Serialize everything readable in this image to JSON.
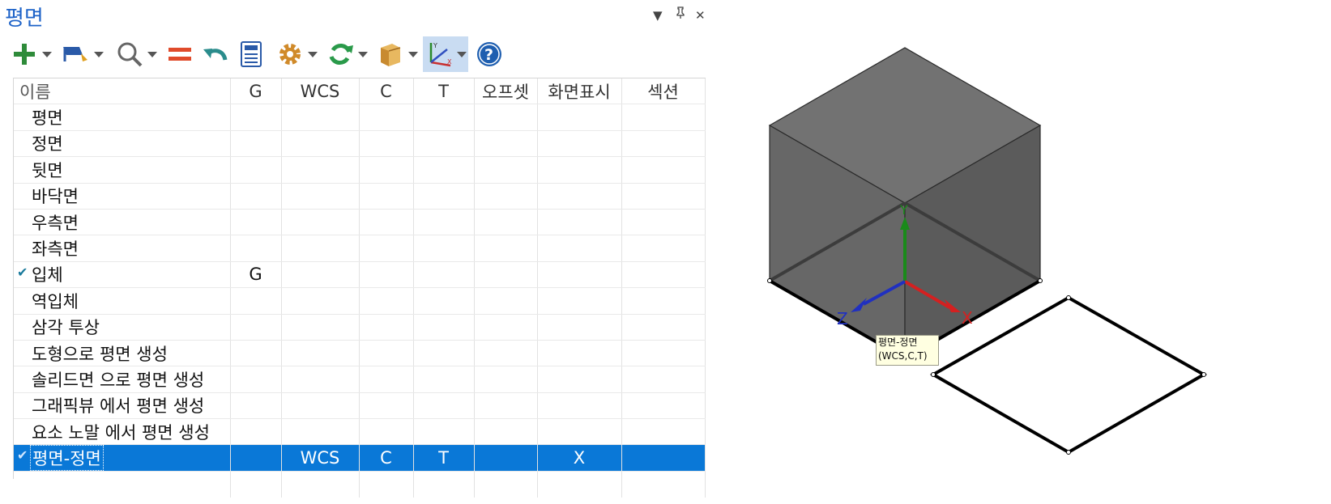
{
  "panel": {
    "title": "평면"
  },
  "window_controls": {
    "dropdown": "▼",
    "pin": "ᵖ",
    "close": "✕"
  },
  "toolbar": {
    "buttons": [
      {
        "icon": "plus-icon",
        "color": "#2e8b3a",
        "has_dropdown": true
      },
      {
        "icon": "plane-flag-icon",
        "color": "#2a5aa8",
        "has_dropdown": true
      },
      {
        "icon": "search-icon",
        "color": "#666666",
        "has_dropdown": true
      },
      {
        "icon": "equals-icon",
        "color": "#e04b2b",
        "has_dropdown": false
      },
      {
        "icon": "undo-icon",
        "color": "#2a8c8c",
        "has_dropdown": false
      },
      {
        "icon": "calculator-icon",
        "color": "#2a5aa8",
        "has_dropdown": false
      },
      {
        "icon": "gear-icon",
        "color": "#d08a2a",
        "has_dropdown": true
      },
      {
        "icon": "refresh-icon",
        "color": "#2a9a4a",
        "has_dropdown": true
      },
      {
        "icon": "box-icon",
        "color": "#d8a040",
        "has_dropdown": true
      },
      {
        "icon": "axes-icon",
        "color": "#6a7a9a",
        "has_dropdown": true,
        "active": true
      },
      {
        "icon": "help-icon",
        "color": "#1f5fb0",
        "has_dropdown": false
      }
    ]
  },
  "table": {
    "columns": [
      "이름",
      "G",
      "WCS",
      "C",
      "T",
      "오프셋",
      "화면표시",
      "섹션"
    ],
    "rows": [
      {
        "name": "평면",
        "g": "",
        "wcs": "",
        "c": "",
        "t": "",
        "offset": "",
        "display": "",
        "section": "",
        "checked": false
      },
      {
        "name": "정면",
        "g": "",
        "wcs": "",
        "c": "",
        "t": "",
        "offset": "",
        "display": "",
        "section": "",
        "checked": false
      },
      {
        "name": "뒷면",
        "g": "",
        "wcs": "",
        "c": "",
        "t": "",
        "offset": "",
        "display": "",
        "section": "",
        "checked": false
      },
      {
        "name": "바닥면",
        "g": "",
        "wcs": "",
        "c": "",
        "t": "",
        "offset": "",
        "display": "",
        "section": "",
        "checked": false
      },
      {
        "name": "우측면",
        "g": "",
        "wcs": "",
        "c": "",
        "t": "",
        "offset": "",
        "display": "",
        "section": "",
        "checked": false
      },
      {
        "name": "좌측면",
        "g": "",
        "wcs": "",
        "c": "",
        "t": "",
        "offset": "",
        "display": "",
        "section": "",
        "checked": false
      },
      {
        "name": "입체",
        "g": "G",
        "wcs": "",
        "c": "",
        "t": "",
        "offset": "",
        "display": "",
        "section": "",
        "checked": true
      },
      {
        "name": "역입체",
        "g": "",
        "wcs": "",
        "c": "",
        "t": "",
        "offset": "",
        "display": "",
        "section": "",
        "checked": false
      },
      {
        "name": "삼각 투상",
        "g": "",
        "wcs": "",
        "c": "",
        "t": "",
        "offset": "",
        "display": "",
        "section": "",
        "checked": false
      },
      {
        "name": "도형으로 평면 생성",
        "g": "",
        "wcs": "",
        "c": "",
        "t": "",
        "offset": "",
        "display": "",
        "section": "",
        "checked": false
      },
      {
        "name": "솔리드면 으로 평면 생성",
        "g": "",
        "wcs": "",
        "c": "",
        "t": "",
        "offset": "",
        "display": "",
        "section": "",
        "checked": false
      },
      {
        "name": "그래픽뷰 에서 평면 생성",
        "g": "",
        "wcs": "",
        "c": "",
        "t": "",
        "offset": "",
        "display": "",
        "section": "",
        "checked": false
      },
      {
        "name": "요소 노말 에서 평면 생성",
        "g": "",
        "wcs": "",
        "c": "",
        "t": "",
        "offset": "",
        "display": "",
        "section": "",
        "checked": false
      },
      {
        "name": "평면-정면",
        "g": "",
        "wcs": "WCS",
        "c": "C",
        "t": "T",
        "offset": "",
        "display": "X",
        "section": "",
        "checked": true,
        "selected": true
      }
    ]
  },
  "viewport": {
    "axes": {
      "x": "X",
      "y": "Y",
      "z": "Z"
    },
    "axis_colors": {
      "x": "#d42020",
      "y": "#1a8a1a",
      "z": "#2030c0"
    },
    "cube_colors": {
      "top": "#727272",
      "left": "#666666",
      "right": "#5a5a5a",
      "inner": "#6e6e6e"
    },
    "tooltip": {
      "line1": "평면-정면",
      "line2": "(WCS,C,T)"
    }
  },
  "colors": {
    "accent": "#1e63c8",
    "selection": "#0a78d7"
  }
}
